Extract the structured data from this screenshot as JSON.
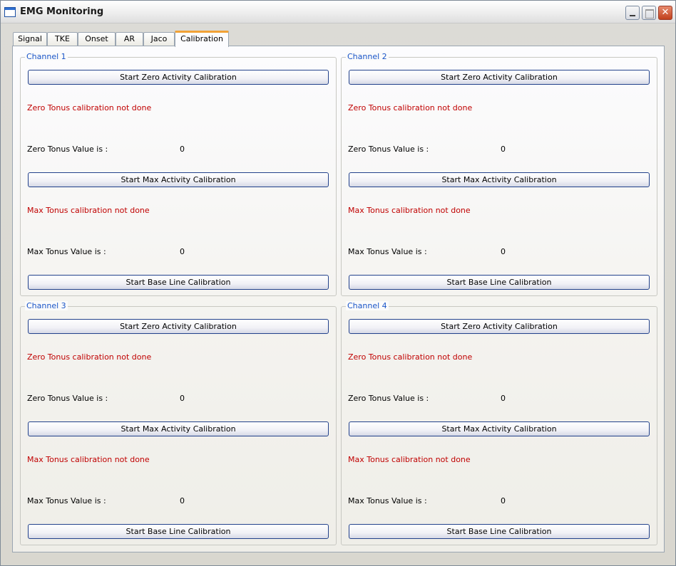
{
  "window": {
    "title": "EMG Monitoring"
  },
  "tabs": [
    {
      "label": "Signal"
    },
    {
      "label": "TKE"
    },
    {
      "label": "Onset"
    },
    {
      "label": "AR"
    },
    {
      "label": "Jaco"
    },
    {
      "label": "Calibration"
    }
  ],
  "active_tab": "Calibration",
  "channels": [
    {
      "title": "Channel 1",
      "zero_button": "Start Zero Activity Calibration",
      "zero_status": "Zero Tonus calibration not done",
      "zero_label": "Zero Tonus Value is :",
      "zero_value": "0",
      "max_button": "Start Max Activity Calibration",
      "max_status": "Max Tonus calibration not done",
      "max_label": "Max Tonus Value is :",
      "max_value": "0",
      "baseline_button": "Start Base Line Calibration"
    },
    {
      "title": "Channel 2",
      "zero_button": "Start Zero Activity Calibration",
      "zero_status": "Zero Tonus calibration not done",
      "zero_label": "Zero Tonus Value is :",
      "zero_value": "0",
      "max_button": "Start Max Activity Calibration",
      "max_status": "Max Tonus calibration not done",
      "max_label": "Max Tonus Value is :",
      "max_value": "0",
      "baseline_button": "Start Base Line Calibration"
    },
    {
      "title": "Channel 3",
      "zero_button": "Start Zero Activity Calibration",
      "zero_status": "Zero Tonus calibration not done",
      "zero_label": "Zero Tonus Value is :",
      "zero_value": "0",
      "max_button": "Start Max Activity Calibration",
      "max_status": "Max Tonus calibration not done",
      "max_label": "Max Tonus Value is :",
      "max_value": "0",
      "baseline_button": "Start Base Line Calibration"
    },
    {
      "title": "Channel 4",
      "zero_button": "Start Zero Activity Calibration",
      "zero_status": "Zero Tonus calibration not done",
      "zero_label": "Zero Tonus Value is :",
      "zero_value": "0",
      "max_button": "Start Max Activity Calibration",
      "max_status": "Max Tonus calibration not done",
      "max_label": "Max Tonus Value is :",
      "max_value": "0",
      "baseline_button": "Start Base Line Calibration"
    }
  ],
  "colors": {
    "status_text": "#c00000",
    "group_title": "#1a55c8",
    "active_tab_accent": "#f2a236"
  }
}
